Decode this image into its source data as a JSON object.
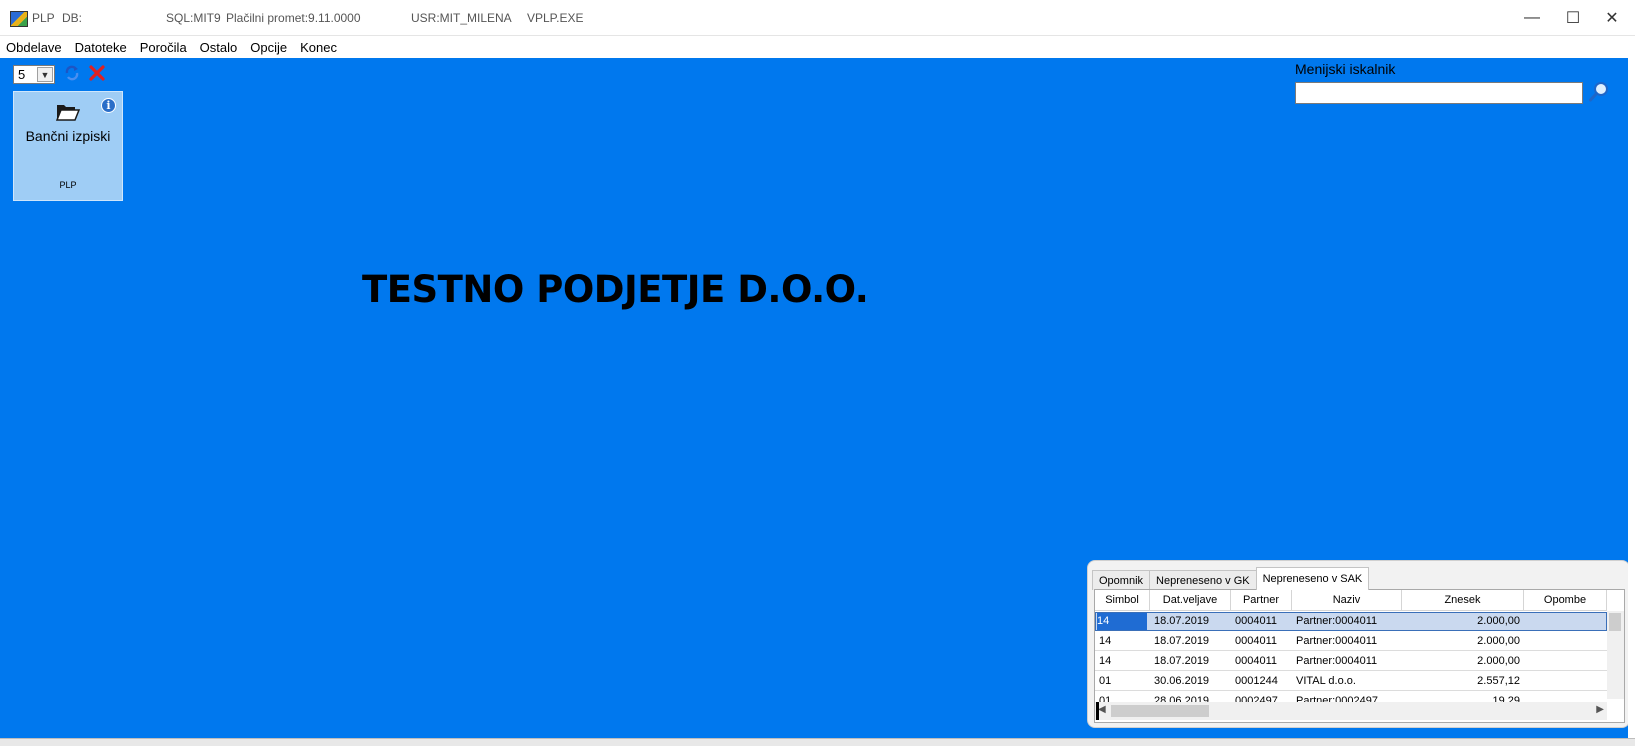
{
  "titlebar": {
    "app": "PLP",
    "db": "DB:",
    "sql": "SQL:MIT9",
    "promet": "Plačilni promet:9.11.0000",
    "user": "USR:MIT_MILENA",
    "exe": "VPLP.EXE",
    "minimize": "—",
    "maximize": "☐",
    "close": "✕"
  },
  "menu": [
    "Obdelave",
    "Datoteke",
    "Poročila",
    "Ostalo",
    "Opcije",
    "Konec"
  ],
  "toolbar": {
    "combo_value": "5"
  },
  "tile": {
    "title": "Bančni izpiski",
    "subtitle": "PLP",
    "info": "i"
  },
  "company": "TESTNO PODJETJE D.O.O.",
  "search": {
    "label": "Menijski iskalnik",
    "value": ""
  },
  "panel": {
    "tabs": [
      "Opomnik",
      "Nepreneseno v GK",
      "Nepreneseno v SAK"
    ],
    "active_tab": 2,
    "columns": [
      "Simbol",
      "Dat.veljave",
      "Partner",
      "Naziv",
      "Znesek",
      "Opombe"
    ],
    "rows": [
      [
        "14",
        "18.07.2019",
        "0004011",
        "Partner:0004011",
        "2.000,00",
        ""
      ],
      [
        "14",
        "18.07.2019",
        "0004011",
        "Partner:0004011",
        "2.000,00",
        ""
      ],
      [
        "14",
        "18.07.2019",
        "0004011",
        "Partner:0004011",
        "2.000,00",
        ""
      ],
      [
        "01",
        "30.06.2019",
        "0001244",
        "VITAL d.o.o.",
        "2.557,12",
        ""
      ],
      [
        "01",
        "28.06.2019",
        "0002497",
        "Partner:0002497",
        "19,29",
        ""
      ]
    ]
  },
  "colors": {
    "background": "#0078ee",
    "tile": "#9fcdf5",
    "selection": "#cad9ef"
  }
}
